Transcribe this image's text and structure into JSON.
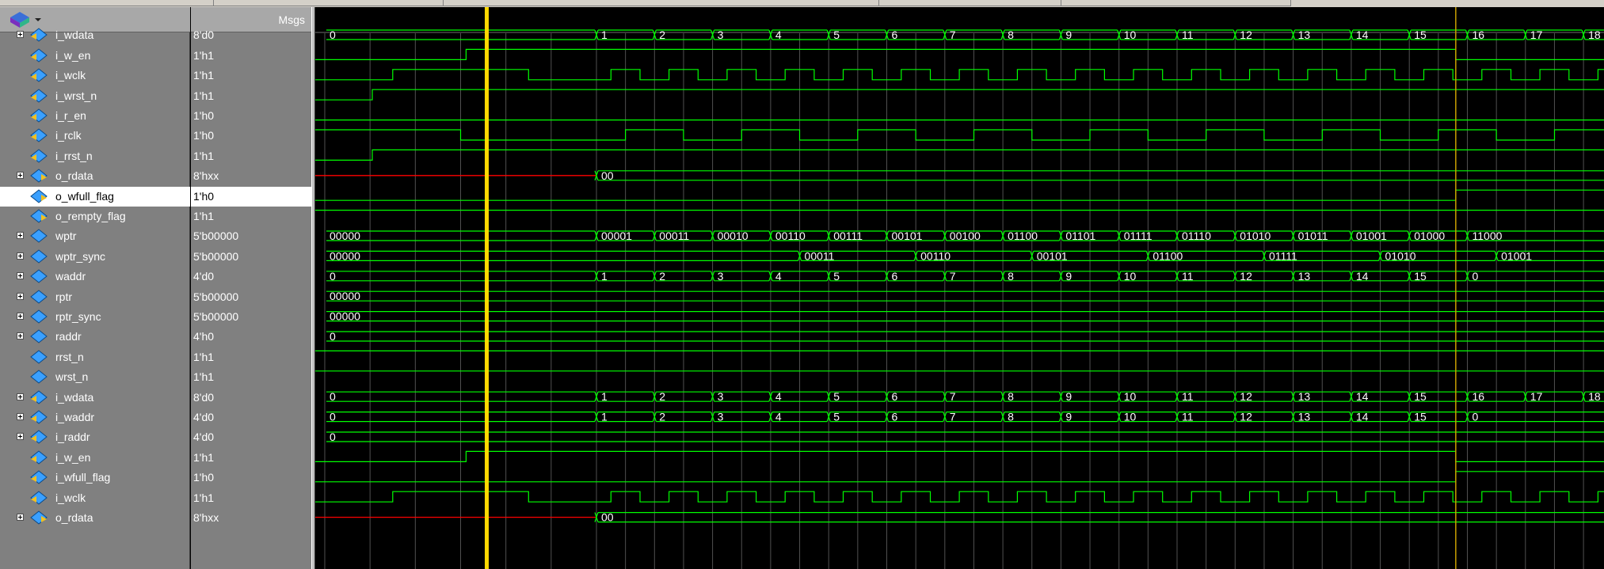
{
  "toolbar": {
    "logo_icon": "questa-logo-icon",
    "dropdown_icon": "chevron-down-icon"
  },
  "header": {
    "msgs_label": "Msgs"
  },
  "colors": {
    "background": "#000000",
    "wave": "#00ff00",
    "unknown": "#ff0000",
    "cursor": "#ffd700",
    "cursor2": "#c8a000",
    "grid": "#505050",
    "panel": "#808080",
    "selected_row": "#ffffff"
  },
  "signals": [
    {
      "name": "i_wdata",
      "value": "8'd0",
      "kind": "bus",
      "expandable": true,
      "icon": "input-port-icon",
      "events": [
        {
          "t": 0,
          "label": "0"
        },
        {
          "t": 1,
          "label": "1"
        },
        {
          "t": 2,
          "label": "2"
        },
        {
          "t": 3,
          "label": "3"
        },
        {
          "t": 4,
          "label": "4"
        },
        {
          "t": 5,
          "label": "5"
        },
        {
          "t": 6,
          "label": "6"
        },
        {
          "t": 7,
          "label": "7"
        },
        {
          "t": 8,
          "label": "8"
        },
        {
          "t": 9,
          "label": "9"
        },
        {
          "t": 10,
          "label": "10"
        },
        {
          "t": 11,
          "label": "11"
        },
        {
          "t": 12,
          "label": "12"
        },
        {
          "t": 13,
          "label": "13"
        },
        {
          "t": 14,
          "label": "14"
        },
        {
          "t": 15,
          "label": "15"
        },
        {
          "t": 16,
          "label": "16"
        },
        {
          "t": 17,
          "label": "17"
        },
        {
          "t": 18,
          "label": "18"
        }
      ]
    },
    {
      "name": "i_w_en",
      "value": "1'h1",
      "kind": "bit",
      "expandable": false,
      "icon": "input-port-icon",
      "pattern": "w_en"
    },
    {
      "name": "i_wclk",
      "value": "1'h1",
      "kind": "bit",
      "expandable": false,
      "icon": "input-port-icon",
      "pattern": "wclk"
    },
    {
      "name": "i_wrst_n",
      "value": "1'h1",
      "kind": "bit",
      "expandable": false,
      "icon": "input-port-icon",
      "pattern": "rst"
    },
    {
      "name": "i_r_en",
      "value": "1'h0",
      "kind": "bit",
      "expandable": false,
      "icon": "input-port-icon",
      "pattern": "low"
    },
    {
      "name": "i_rclk",
      "value": "1'h0",
      "kind": "bit",
      "expandable": false,
      "icon": "input-port-icon",
      "pattern": "rclk"
    },
    {
      "name": "i_rrst_n",
      "value": "1'h1",
      "kind": "bit",
      "expandable": false,
      "icon": "input-port-icon",
      "pattern": "rst"
    },
    {
      "name": "o_rdata",
      "value": "8'hxx",
      "kind": "bus",
      "expandable": true,
      "icon": "output-port-icon",
      "unknown_until": 1,
      "events": [
        {
          "t": 1,
          "label": "00"
        }
      ]
    },
    {
      "name": "o_wfull_flag",
      "value": "1'h0",
      "kind": "bit",
      "expandable": false,
      "icon": "output-port-icon",
      "pattern": "wfull",
      "selected": true
    },
    {
      "name": "o_rempty_flag",
      "value": "1'h1",
      "kind": "bit",
      "expandable": false,
      "icon": "output-port-icon",
      "pattern": "high"
    },
    {
      "name": "wptr",
      "value": "5'b00000",
      "kind": "bus",
      "expandable": true,
      "icon": "internal-signal-icon",
      "events": [
        {
          "t": 0,
          "label": "00000"
        },
        {
          "t": 1,
          "label": "00001"
        },
        {
          "t": 2,
          "label": "00011"
        },
        {
          "t": 3,
          "label": "00010"
        },
        {
          "t": 4,
          "label": "00110"
        },
        {
          "t": 5,
          "label": "00111"
        },
        {
          "t": 6,
          "label": "00101"
        },
        {
          "t": 7,
          "label": "00100"
        },
        {
          "t": 8,
          "label": "01100"
        },
        {
          "t": 9,
          "label": "01101"
        },
        {
          "t": 10,
          "label": "01111"
        },
        {
          "t": 11,
          "label": "01110"
        },
        {
          "t": 12,
          "label": "01010"
        },
        {
          "t": 13,
          "label": "01011"
        },
        {
          "t": 14,
          "label": "01001"
        },
        {
          "t": 15,
          "label": "01000"
        },
        {
          "t": 16,
          "label": "11000"
        }
      ]
    },
    {
      "name": "wptr_sync",
      "value": "5'b00000",
      "kind": "bus",
      "expandable": true,
      "icon": "internal-signal-icon",
      "events": [
        {
          "t": 0,
          "label": "00000"
        },
        {
          "t": 4.5,
          "label": "00011"
        },
        {
          "t": 6.5,
          "label": "00110"
        },
        {
          "t": 8.5,
          "label": "00101"
        },
        {
          "t": 10.5,
          "label": "01100"
        },
        {
          "t": 12.5,
          "label": "01111"
        },
        {
          "t": 14.5,
          "label": "01010"
        },
        {
          "t": 16.5,
          "label": "01001"
        }
      ]
    },
    {
      "name": "waddr",
      "value": "4'd0",
      "kind": "bus",
      "expandable": true,
      "icon": "internal-signal-icon",
      "events": [
        {
          "t": 0,
          "label": "0"
        },
        {
          "t": 1,
          "label": "1"
        },
        {
          "t": 2,
          "label": "2"
        },
        {
          "t": 3,
          "label": "3"
        },
        {
          "t": 4,
          "label": "4"
        },
        {
          "t": 5,
          "label": "5"
        },
        {
          "t": 6,
          "label": "6"
        },
        {
          "t": 7,
          "label": "7"
        },
        {
          "t": 8,
          "label": "8"
        },
        {
          "t": 9,
          "label": "9"
        },
        {
          "t": 10,
          "label": "10"
        },
        {
          "t": 11,
          "label": "11"
        },
        {
          "t": 12,
          "label": "12"
        },
        {
          "t": 13,
          "label": "13"
        },
        {
          "t": 14,
          "label": "14"
        },
        {
          "t": 15,
          "label": "15"
        },
        {
          "t": 16,
          "label": "0"
        }
      ]
    },
    {
      "name": "rptr",
      "value": "5'b00000",
      "kind": "bus",
      "expandable": true,
      "icon": "internal-signal-icon",
      "events": [
        {
          "t": 0,
          "label": "00000"
        }
      ]
    },
    {
      "name": "rptr_sync",
      "value": "5'b00000",
      "kind": "bus",
      "expandable": true,
      "icon": "internal-signal-icon",
      "events": [
        {
          "t": 0,
          "label": "00000"
        }
      ]
    },
    {
      "name": "raddr",
      "value": "4'h0",
      "kind": "bus",
      "expandable": true,
      "icon": "internal-signal-icon",
      "events": [
        {
          "t": 0,
          "label": "0"
        }
      ]
    },
    {
      "name": "rrst_n",
      "value": "1'h1",
      "kind": "bit",
      "expandable": false,
      "icon": "internal-signal-icon",
      "pattern": "high"
    },
    {
      "name": "wrst_n",
      "value": "1'h1",
      "kind": "bit",
      "expandable": false,
      "icon": "internal-signal-icon",
      "pattern": "high"
    },
    {
      "name": "i_wdata",
      "value": "8'd0",
      "kind": "bus",
      "expandable": true,
      "icon": "input-port-icon",
      "events": [
        {
          "t": 0,
          "label": "0"
        },
        {
          "t": 1,
          "label": "1"
        },
        {
          "t": 2,
          "label": "2"
        },
        {
          "t": 3,
          "label": "3"
        },
        {
          "t": 4,
          "label": "4"
        },
        {
          "t": 5,
          "label": "5"
        },
        {
          "t": 6,
          "label": "6"
        },
        {
          "t": 7,
          "label": "7"
        },
        {
          "t": 8,
          "label": "8"
        },
        {
          "t": 9,
          "label": "9"
        },
        {
          "t": 10,
          "label": "10"
        },
        {
          "t": 11,
          "label": "11"
        },
        {
          "t": 12,
          "label": "12"
        },
        {
          "t": 13,
          "label": "13"
        },
        {
          "t": 14,
          "label": "14"
        },
        {
          "t": 15,
          "label": "15"
        },
        {
          "t": 16,
          "label": "16"
        },
        {
          "t": 17,
          "label": "17"
        },
        {
          "t": 18,
          "label": "18"
        }
      ]
    },
    {
      "name": "i_waddr",
      "value": "4'd0",
      "kind": "bus",
      "expandable": true,
      "icon": "input-port-icon",
      "events": [
        {
          "t": 0,
          "label": "0"
        },
        {
          "t": 1,
          "label": "1"
        },
        {
          "t": 2,
          "label": "2"
        },
        {
          "t": 3,
          "label": "3"
        },
        {
          "t": 4,
          "label": "4"
        },
        {
          "t": 5,
          "label": "5"
        },
        {
          "t": 6,
          "label": "6"
        },
        {
          "t": 7,
          "label": "7"
        },
        {
          "t": 8,
          "label": "8"
        },
        {
          "t": 9,
          "label": "9"
        },
        {
          "t": 10,
          "label": "10"
        },
        {
          "t": 11,
          "label": "11"
        },
        {
          "t": 12,
          "label": "12"
        },
        {
          "t": 13,
          "label": "13"
        },
        {
          "t": 14,
          "label": "14"
        },
        {
          "t": 15,
          "label": "15"
        },
        {
          "t": 16,
          "label": "0"
        }
      ]
    },
    {
      "name": "i_raddr",
      "value": "4'd0",
      "kind": "bus",
      "expandable": true,
      "icon": "input-port-icon",
      "events": [
        {
          "t": 0,
          "label": "0"
        }
      ]
    },
    {
      "name": "i_w_en",
      "value": "1'h1",
      "kind": "bit",
      "expandable": false,
      "icon": "input-port-icon",
      "pattern": "w_en"
    },
    {
      "name": "i_wfull_flag",
      "value": "1'h0",
      "kind": "bit",
      "expandable": false,
      "icon": "input-port-icon",
      "pattern": "wfull"
    },
    {
      "name": "i_wclk",
      "value": "1'h1",
      "kind": "bit",
      "expandable": false,
      "icon": "input-port-icon",
      "pattern": "wclk"
    },
    {
      "name": "o_rdata",
      "value": "8'hxx",
      "kind": "bus",
      "expandable": true,
      "icon": "output-port-icon",
      "unknown_until": 1,
      "events": [
        {
          "t": 1,
          "label": "00"
        }
      ]
    }
  ]
}
